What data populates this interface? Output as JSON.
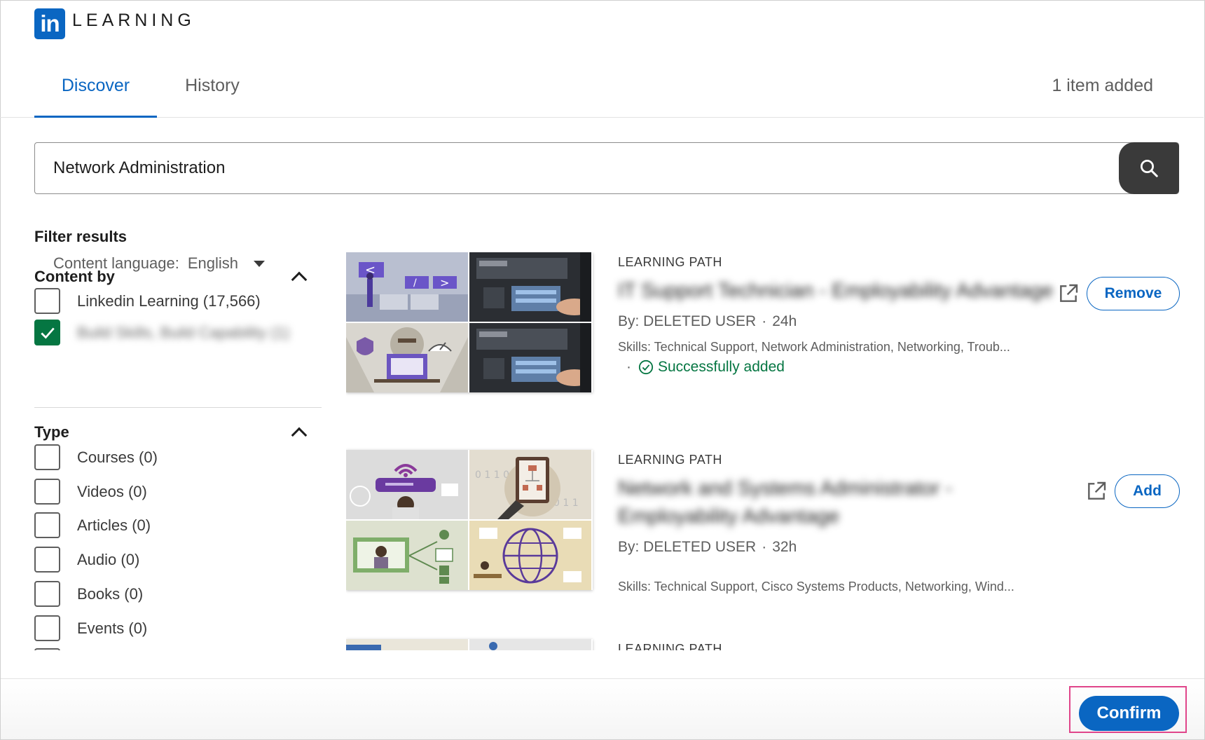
{
  "brand": {
    "logo_mark": "in",
    "product": "LEARNING"
  },
  "tabs": [
    {
      "label": "Discover",
      "active": true
    },
    {
      "label": "History",
      "active": false
    }
  ],
  "items_added": "1 item added",
  "search": {
    "value": "Network Administration",
    "icon": "search-icon"
  },
  "filters": {
    "title": "Filter results",
    "language": {
      "label": "Content language:",
      "value": "English"
    },
    "content_by": {
      "title": "Content by",
      "options": [
        {
          "label": "Linkedin Learning (17,566)",
          "checked": false
        },
        {
          "label": "Build Skills, Build Capability (1)",
          "checked": true,
          "blurred": true
        }
      ]
    },
    "type": {
      "title": "Type",
      "options": [
        {
          "label": "Courses (0)",
          "checked": false
        },
        {
          "label": "Videos (0)",
          "checked": false
        },
        {
          "label": "Articles (0)",
          "checked": false
        },
        {
          "label": "Audio (0)",
          "checked": false
        },
        {
          "label": "Books (0)",
          "checked": false
        },
        {
          "label": "Events (0)",
          "checked": false
        }
      ]
    }
  },
  "results": [
    {
      "kind": "LEARNING PATH",
      "title": "IT Support Technician - Employability Advantage",
      "by": "By: DELETED USER",
      "duration": "24h",
      "skills": "Skills: Technical Support, Network Administration, Networking, Troub...",
      "status": "Successfully added",
      "action": "Remove"
    },
    {
      "kind": "LEARNING PATH",
      "title": "Network and Systems Administrator - Employability Advantage",
      "by": "By: DELETED USER",
      "duration": "32h",
      "skills": "Skills: Technical Support, Cisco Systems Products, Networking, Wind...",
      "status": "",
      "action": "Add"
    },
    {
      "kind": "LEARNING PATH"
    }
  ],
  "footer": {
    "confirm_label": "Confirm"
  },
  "colors": {
    "brand": "#0a66c2",
    "success": "#057642",
    "highlight": "#e0458a",
    "search_button": "#3a3a3a"
  }
}
